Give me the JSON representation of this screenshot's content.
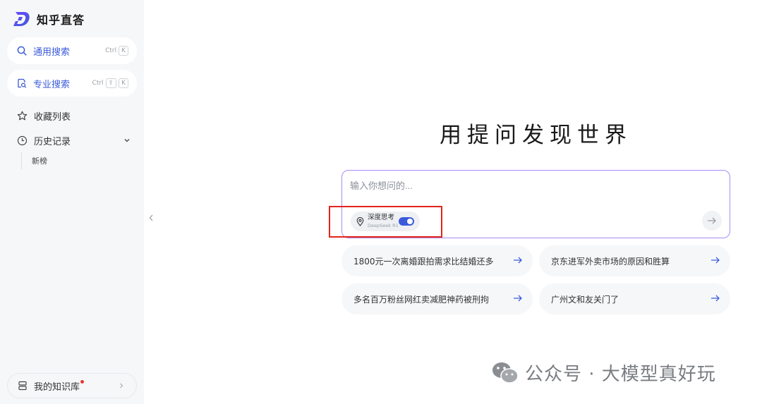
{
  "sidebar": {
    "app_name": "知乎直答",
    "general_search": {
      "label": "通用搜索",
      "shortcut": [
        "Ctrl",
        "K"
      ]
    },
    "pro_search": {
      "label": "专业搜索",
      "shortcut": [
        "Ctrl",
        "⇧",
        "K"
      ]
    },
    "favorites": "收藏列表",
    "history": {
      "label": "历史记录",
      "items": [
        "新榜"
      ]
    },
    "knowledge_base": "我的知识库"
  },
  "main": {
    "headline": "用提问发现世界",
    "search": {
      "placeholder": "输入你想问的...",
      "value": "",
      "deep_think": {
        "label": "深度思考",
        "model": "DeepSeek R1",
        "enabled": true
      }
    },
    "suggestions": [
      "1800元一次离婚跟拍需求比结婚还多",
      "京东进军外卖市场的原因和胜算",
      "多名百万粉丝网红卖减肥神药被刑拘",
      "广州文和友关门了"
    ]
  },
  "watermark": "公众号 · 大模型真好玩",
  "colors": {
    "accent": "#3b5bdb",
    "border_purple": "#a78bfa",
    "highlight_red": "#e3241b"
  }
}
